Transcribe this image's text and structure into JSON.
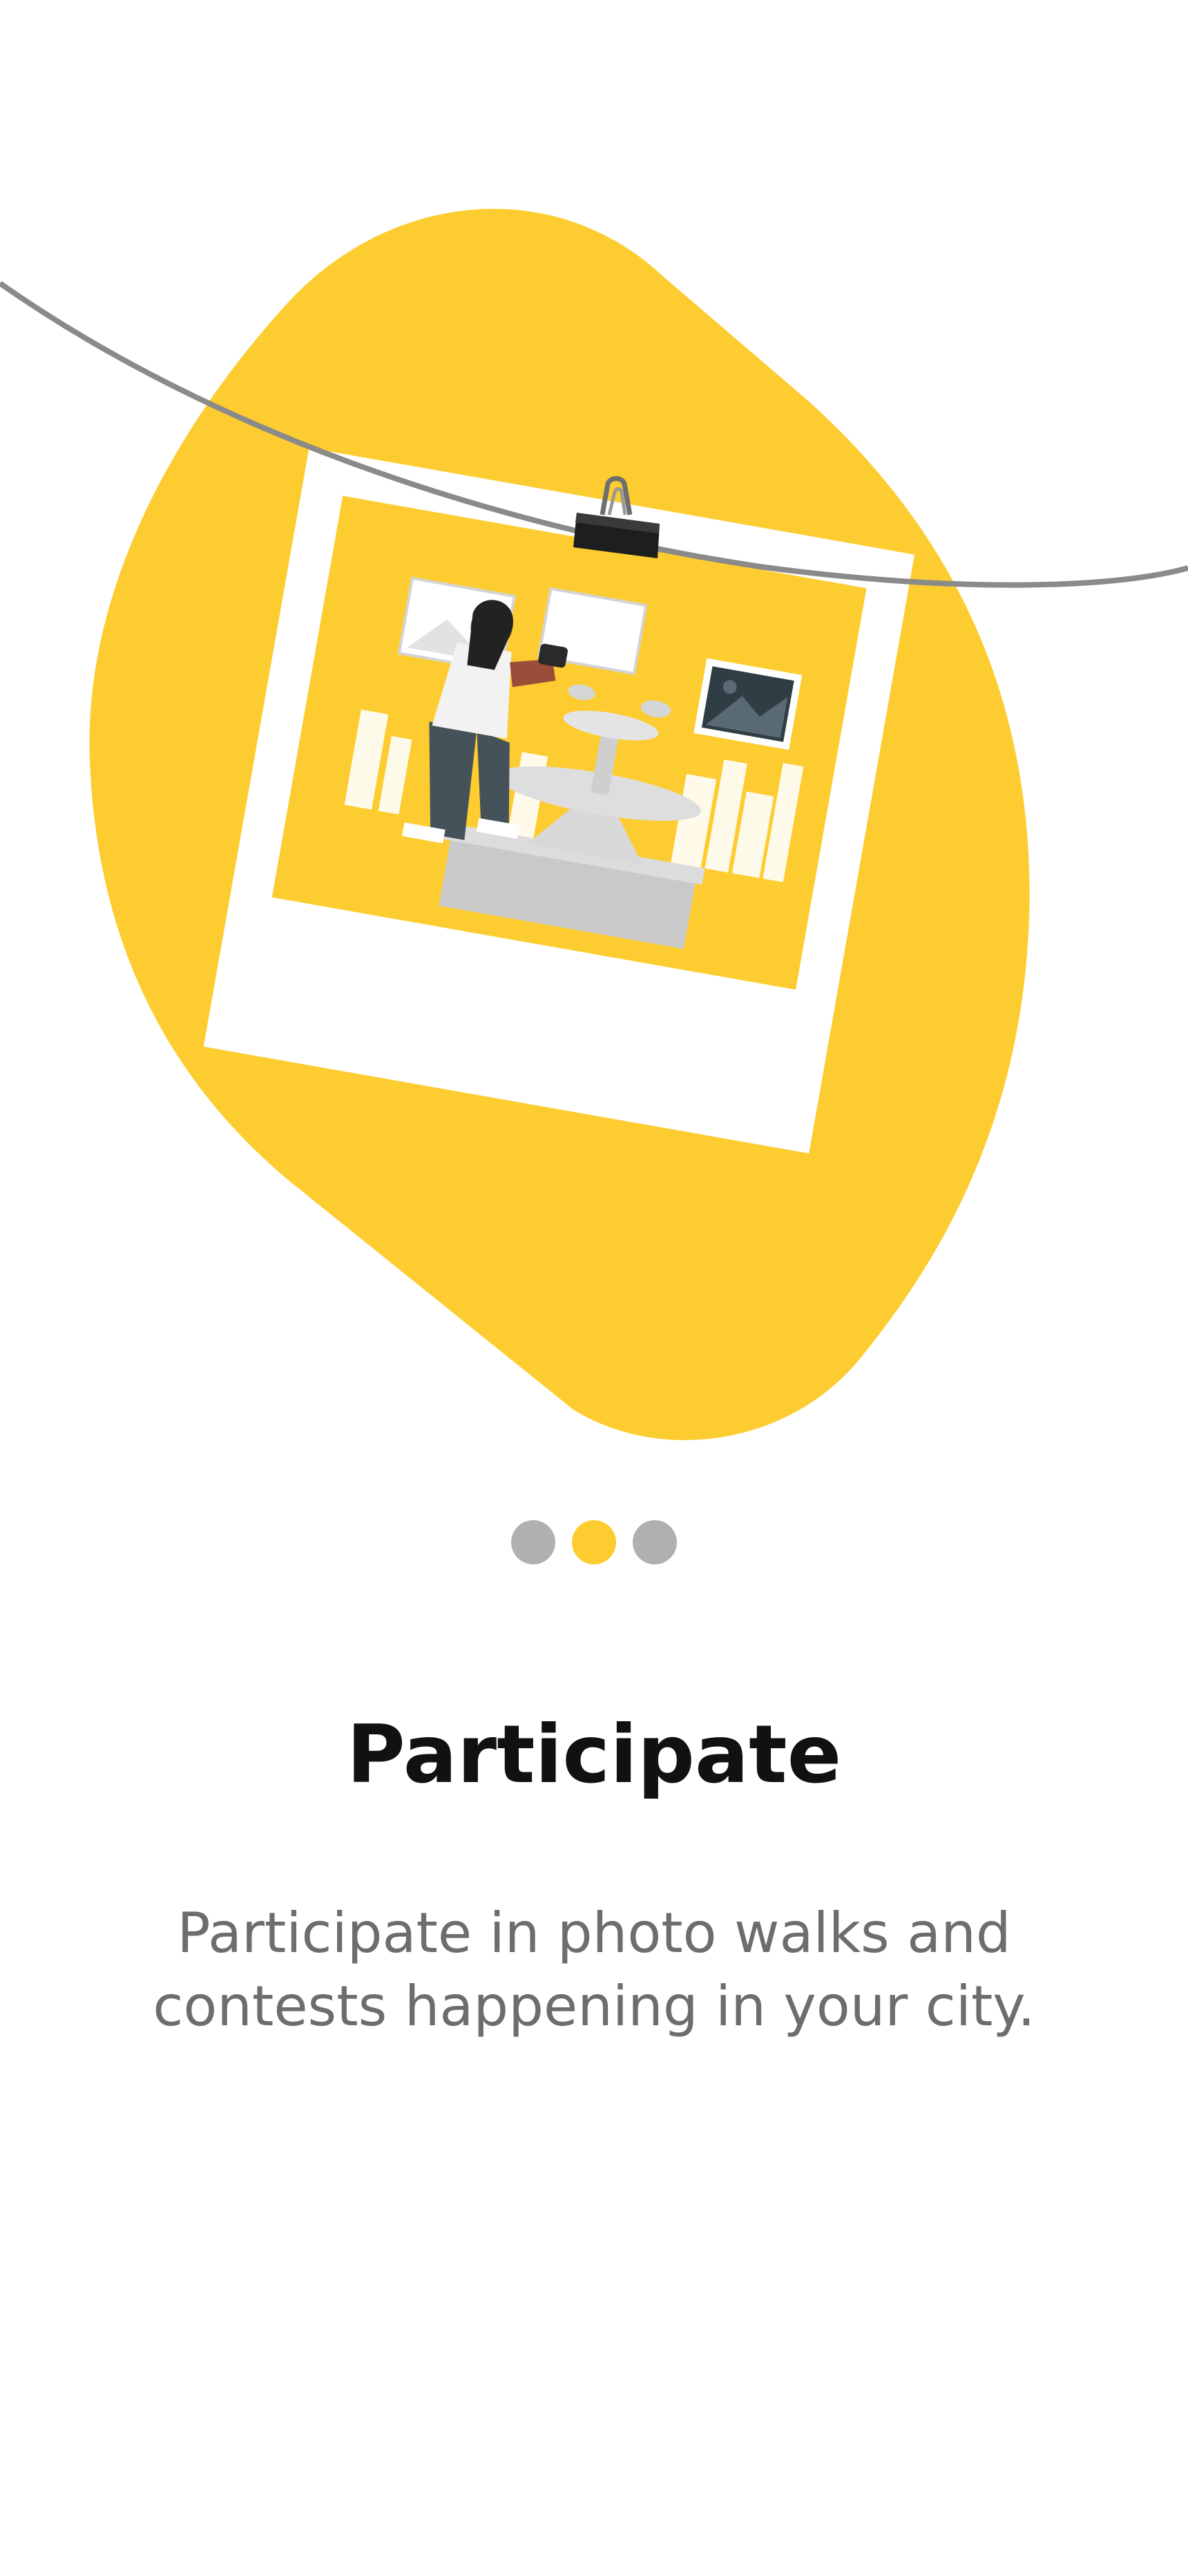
{
  "onboarding": {
    "title": "Participate",
    "description": "Participate in photo walks and contests happening in your city.",
    "pager": {
      "total_pages": 3,
      "active_page": 2
    }
  },
  "colors": {
    "accent": "#fdcc30",
    "dot_inactive": "#b0b0b0",
    "title": "#111111",
    "description": "#6d6d6d"
  },
  "illustration": {
    "icons": [
      "hanging-polaroid-photo",
      "binder-clip-icon",
      "photographer-figure",
      "fountain",
      "pigeons",
      "framed-pictures"
    ]
  }
}
